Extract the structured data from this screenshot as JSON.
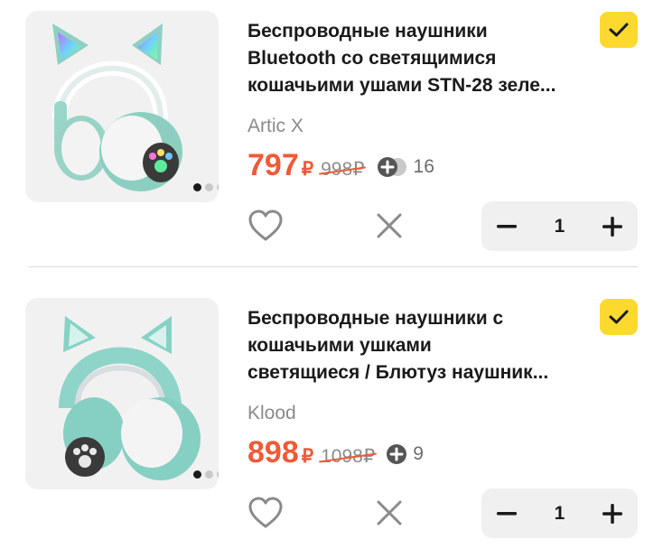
{
  "cart_items": [
    {
      "title_lines": [
        "Беспроводные наушники",
        "Bluetooth со светящимися",
        "кошачьими ушами STN-28 зеле..."
      ],
      "seller": "Artic X",
      "price": "797",
      "currency": "₽",
      "old_price": "998₽",
      "bonus_count": "16",
      "quantity": "1",
      "selected": true,
      "image_icon": "cat-ear-headphones-icon",
      "image_dots": 3,
      "active_dot": 0
    },
    {
      "title_lines": [
        "Беспроводные наушники с",
        "кошачьими ушками",
        "светящиеся / Блютуз наушник..."
      ],
      "seller": "Klood",
      "price": "898",
      "currency": "₽",
      "old_price": "1098₽",
      "bonus_count": "9",
      "quantity": "1",
      "selected": true,
      "image_icon": "cat-ear-headphones-icon",
      "image_dots": 3,
      "active_dot": 0
    }
  ],
  "colors": {
    "price": "#ef5a37",
    "checkbox": "#fcd92f",
    "stepper_bg": "#f0f0f0",
    "muted_text": "#8a8a8a"
  },
  "icons": {
    "favorite": "heart-outline-icon",
    "remove": "close-icon",
    "decrease": "minus-icon",
    "increase": "plus-icon",
    "selected": "checkmark-icon",
    "bonus": "plus-points-icon"
  }
}
